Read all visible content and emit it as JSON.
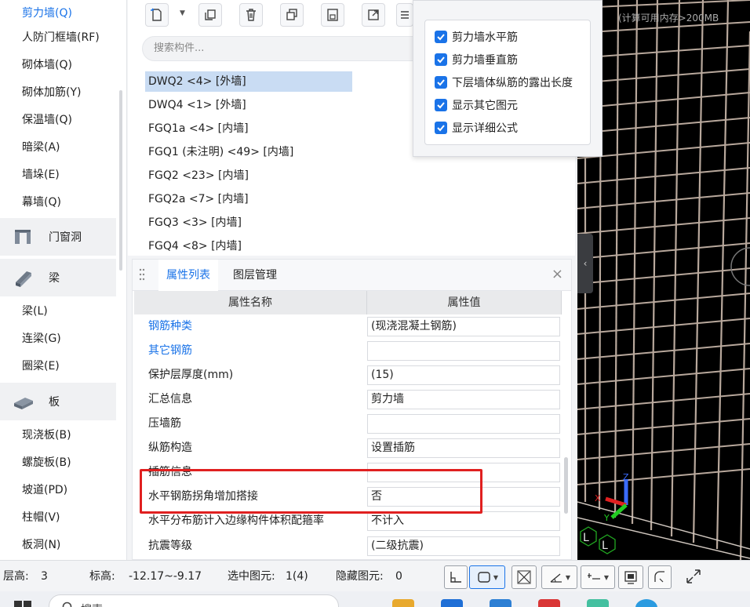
{
  "sidebar": {
    "items": [
      {
        "label": "剪力墙(Q)",
        "active": true
      },
      {
        "label": "人防门框墙(RF)"
      },
      {
        "label": "砌体墙(Q)"
      },
      {
        "label": "砌体加筋(Y)"
      },
      {
        "label": "保温墙(Q)"
      },
      {
        "label": "暗梁(A)"
      },
      {
        "label": "墙垛(E)"
      },
      {
        "label": "幕墙(Q)"
      }
    ],
    "group_door": {
      "label": "门窗洞",
      "icon": "door-window-icon"
    },
    "group_beam": {
      "label": "梁",
      "icon": "beam-icon"
    },
    "beam_items": [
      {
        "label": "梁(L)"
      },
      {
        "label": "连梁(G)"
      },
      {
        "label": "圈梁(E)"
      }
    ],
    "group_slab": {
      "label": "板",
      "icon": "slab-icon"
    },
    "slab_items": [
      {
        "label": "现浇板(B)"
      },
      {
        "label": "螺旋板(B)"
      },
      {
        "label": "坡道(PD)"
      },
      {
        "label": "柱帽(V)"
      },
      {
        "label": "板洞(N)"
      }
    ]
  },
  "components": {
    "search_placeholder": "搜索构件...",
    "items": [
      {
        "label": "DWQ2 <4> [外墙]",
        "selected": true
      },
      {
        "label": "DWQ4 <1> [外墙]"
      },
      {
        "label": "FGQ1a <4> [内墙]"
      },
      {
        "label": "FGQ1 (未注明)  <49> [内墙]"
      },
      {
        "label": "FGQ2 <23> [内墙]"
      },
      {
        "label": "FGQ2a <7> [内墙]"
      },
      {
        "label": "FGQ3 <3> [内墙]"
      },
      {
        "label": "FGQ4 <8> [内墙]"
      }
    ]
  },
  "properties": {
    "tabs": [
      "属性列表",
      "图层管理"
    ],
    "col_name": "属性名称",
    "col_value": "属性值",
    "rows": [
      {
        "name": "钢筋种类",
        "value": "(现浇混凝土钢筋)",
        "link": true
      },
      {
        "name": "其它钢筋",
        "value": "",
        "link": true
      },
      {
        "name": "保护层厚度(mm)",
        "value": "(15)"
      },
      {
        "name": "汇总信息",
        "value": "剪力墙"
      },
      {
        "name": "压墙筋",
        "value": ""
      },
      {
        "name": "纵筋构造",
        "value": "设置插筋"
      },
      {
        "name": "插筋信息",
        "value": ""
      },
      {
        "name": "水平钢筋拐角增加搭接",
        "value": "否"
      },
      {
        "name": "水平分布筋计入边缘构件体积配箍率",
        "value": "不计入"
      },
      {
        "name": "抗震等级",
        "value": "(二级抗震)"
      }
    ]
  },
  "popup": {
    "options": [
      {
        "label": "剪力墙水平筋",
        "checked": true
      },
      {
        "label": "剪力墙垂直筋",
        "checked": true
      },
      {
        "label": "下层墙体纵筋的露出长度",
        "checked": true
      },
      {
        "label": "显示其它图元",
        "checked": true
      },
      {
        "label": "显示详细公式",
        "checked": true
      }
    ]
  },
  "viewport": {
    "overlay_text": "(计算可用内存>200MB"
  },
  "statusbar": {
    "floor_label": "层高:",
    "floor_value": "3",
    "elev_label": "标高:",
    "elev_value": "-12.17~-9.17",
    "selected_label": "选中图元:",
    "selected_value": "1(4)",
    "hidden_label": "隐藏图元:",
    "hidden_value": "0"
  },
  "taskbar": {
    "search_text": "搜索"
  },
  "colors": {
    "accent": "#1a73e8",
    "highlight_box": "#e02020",
    "selected_row": "#c9dcf3"
  }
}
